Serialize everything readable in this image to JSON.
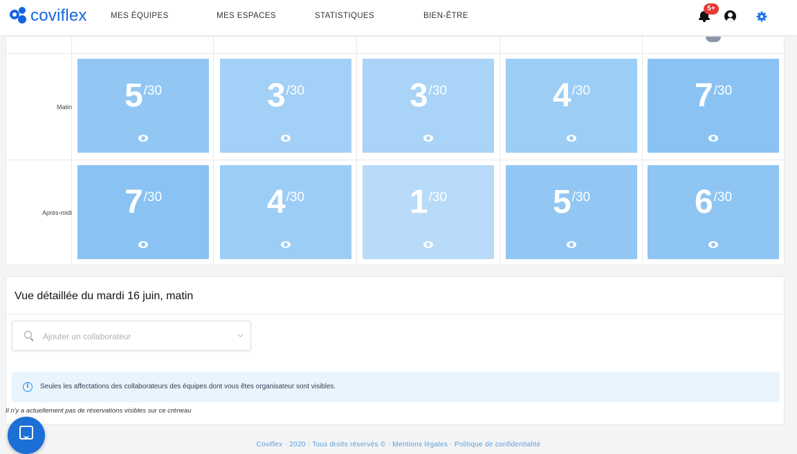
{
  "app": {
    "name": "coviflex"
  },
  "nav": {
    "items": [
      {
        "label": "MES ÉQUIPES"
      },
      {
        "label": "MES ESPACES"
      },
      {
        "label": "STATISTIQUES"
      },
      {
        "label": "BIEN-ÊTRE"
      }
    ],
    "notification_badge": "5+"
  },
  "colors": {
    "brand": "#1565e0",
    "slot_high": "#89c2f3",
    "slot_mid": "#98cbf5",
    "slot_low": "#acd5f7",
    "slot_lowest": "#b9dbf8",
    "badge": "#e53935"
  },
  "schedule": {
    "capacity_label": "/30",
    "rows": [
      {
        "label": "Matin",
        "slots": [
          {
            "count": "5",
            "color": "#92c7f4"
          },
          {
            "count": "3",
            "color": "#a3d0f6"
          },
          {
            "count": "3",
            "color": "#a9d3f7"
          },
          {
            "count": "4",
            "color": "#9ccdf5"
          },
          {
            "count": "7",
            "color": "#8ac3f3"
          }
        ]
      },
      {
        "label": "Après-midi",
        "slots": [
          {
            "count": "7",
            "color": "#8ac3f3"
          },
          {
            "count": "4",
            "color": "#9ccdf5"
          },
          {
            "count": "1",
            "color": "#b8dbf9"
          },
          {
            "count": "5",
            "color": "#92c7f4"
          },
          {
            "count": "6",
            "color": "#8ec5f3"
          }
        ]
      }
    ]
  },
  "detail": {
    "title": "Vue détaillée du mardi 16 juin, matin",
    "search_placeholder": "Ajouter un collaborateur",
    "info_text": "Seules les affectations des collaborateurs des équipes dont vous êtes organisateur sont visibles.",
    "empty_text": "Il n'y a actuellement pas de réservations visibles sur ce créneau"
  },
  "footer": {
    "text": "Coviflex · 2020 · Tous droits réservés © · Mentions légales · Politique de confidentialité"
  }
}
